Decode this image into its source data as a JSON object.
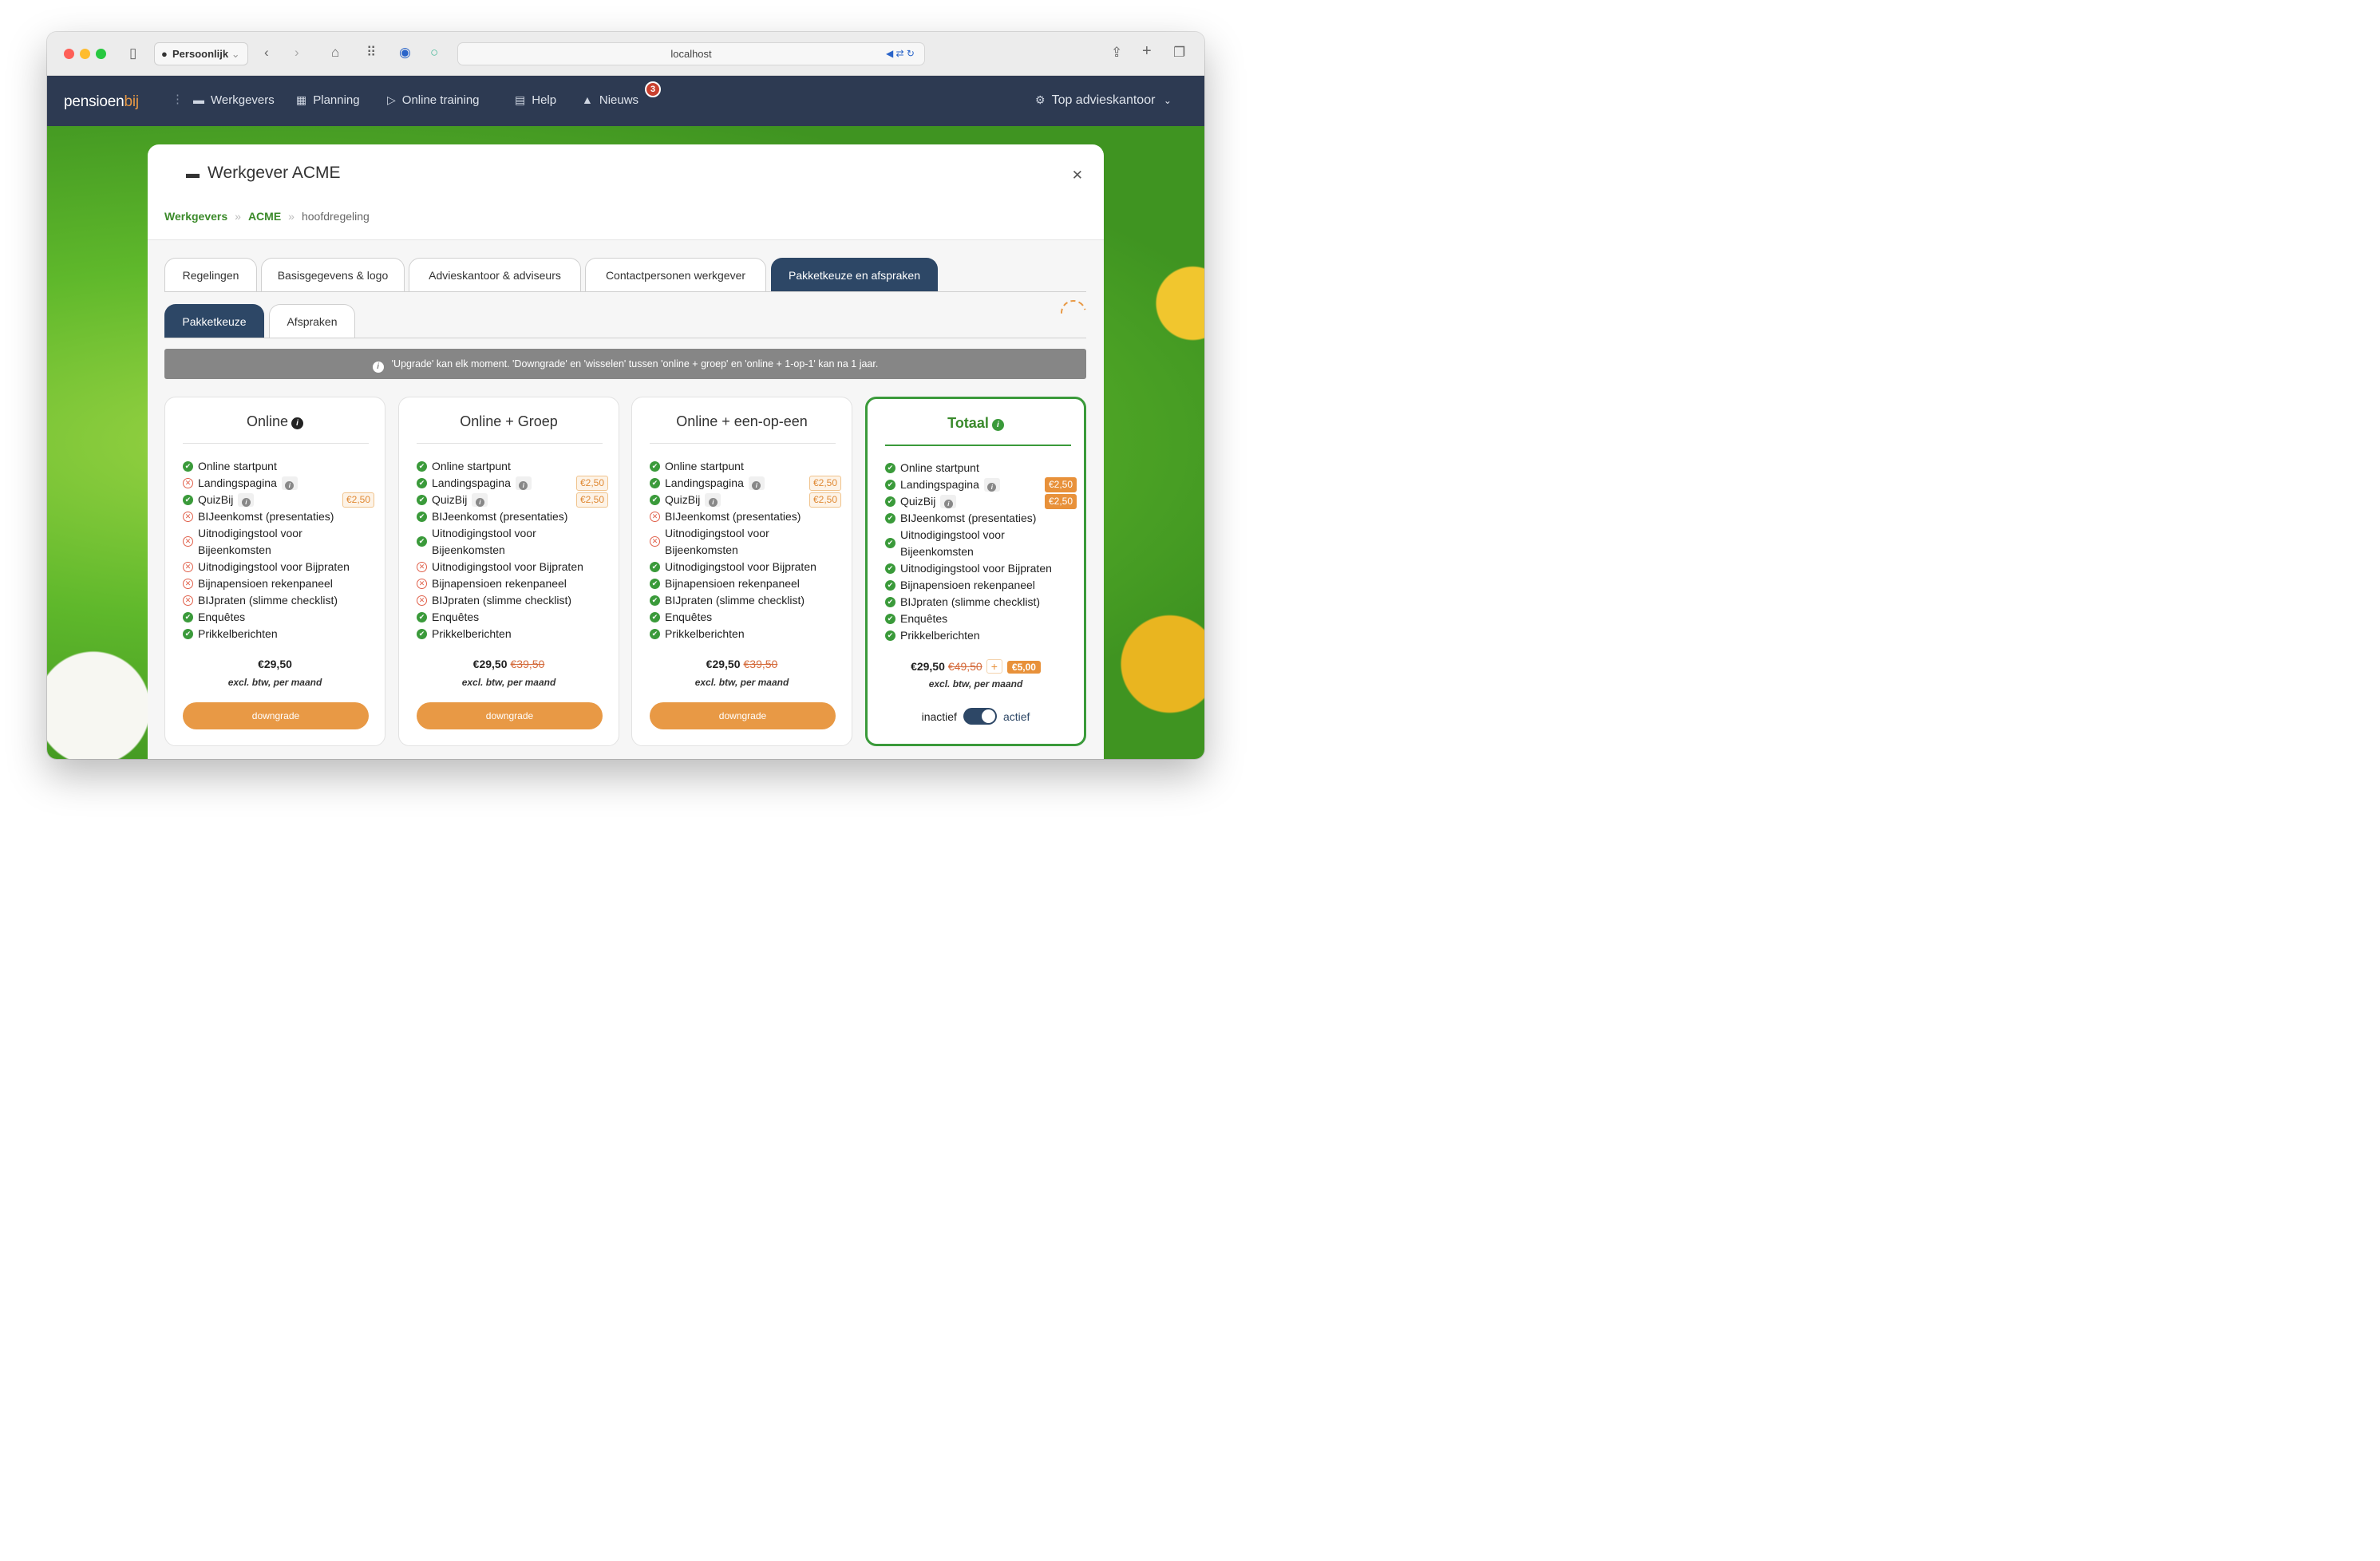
{
  "browser": {
    "profile": "Persoonlijk",
    "url": "localhost"
  },
  "nav": {
    "logo_a": "pensioen",
    "logo_b": "bij",
    "items": [
      {
        "label": "Werkgevers",
        "icon": "briefcase-icon"
      },
      {
        "label": "Planning",
        "icon": "calendar-icon"
      },
      {
        "label": "Online training",
        "icon": "play-icon"
      },
      {
        "label": "Help",
        "icon": "book-icon"
      },
      {
        "label": "Nieuws",
        "icon": "bell-icon",
        "badge": "3"
      }
    ],
    "account": "Top advieskantoor"
  },
  "modal": {
    "title": "Werkgever ACME",
    "breadcrumb": [
      "Werkgevers",
      "ACME",
      "hoofdregeling"
    ],
    "tabs": [
      "Regelingen",
      "Basisgegevens & logo",
      "Advieskantoor & adviseurs",
      "Contactpersonen werkgever",
      "Pakketkeuze en afspraken"
    ],
    "subtabs": [
      "Pakketkeuze",
      "Afspraken"
    ],
    "info": "'Upgrade' kan elk moment. 'Downgrade' en 'wisselen' tussen 'online + groep' en 'online + 1-op-1' kan na 1 jaar."
  },
  "features": [
    "Online startpunt",
    "Landingspagina",
    "QuizBij",
    "BIJeenkomst (presentaties)",
    "Uitnodigingstool voor Bijeenkomsten",
    "Uitnodigingstool voor Bijpraten",
    "Bijnapensioen rekenpaneel",
    "BIJpraten (slimme checklist)",
    "Enquêtes",
    "Prikkelberichten"
  ],
  "cards": [
    {
      "title": "Online",
      "ok": [
        true,
        false,
        true,
        false,
        false,
        false,
        false,
        false,
        true,
        true
      ],
      "prices": {
        "2": "€2,50"
      },
      "price": "€29,50",
      "old": "",
      "sub": "excl. btw, per maand",
      "button": "downgrade"
    },
    {
      "title": "Online + Groep",
      "ok": [
        true,
        true,
        true,
        true,
        true,
        false,
        false,
        false,
        true,
        true
      ],
      "prices": {
        "1": "€2,50",
        "2": "€2,50"
      },
      "price": "€29,50",
      "old": "€39,50",
      "sub": "excl. btw, per maand",
      "button": "downgrade"
    },
    {
      "title": "Online + een-op-een",
      "ok": [
        true,
        true,
        true,
        false,
        false,
        true,
        true,
        true,
        true,
        true
      ],
      "prices": {
        "1": "€2,50",
        "2": "€2,50"
      },
      "price": "€29,50",
      "old": "€39,50",
      "sub": "excl. btw, per maand",
      "button": "downgrade"
    },
    {
      "title": "Totaal",
      "ok": [
        true,
        true,
        true,
        true,
        true,
        true,
        true,
        true,
        true,
        true
      ],
      "prices": {
        "1": "€2,50",
        "2": "€2,50"
      },
      "price": "€29,50",
      "old": "€49,50",
      "plus": "+",
      "extra": "€5,00",
      "sub": "excl. btw, per maand",
      "toggle_off": "inactief",
      "toggle_on": "actief"
    }
  ],
  "colors": {
    "nav": "#2d3a52",
    "accent": "#e89945",
    "green": "#3a9a3a",
    "tab_active": "#2d4766"
  }
}
